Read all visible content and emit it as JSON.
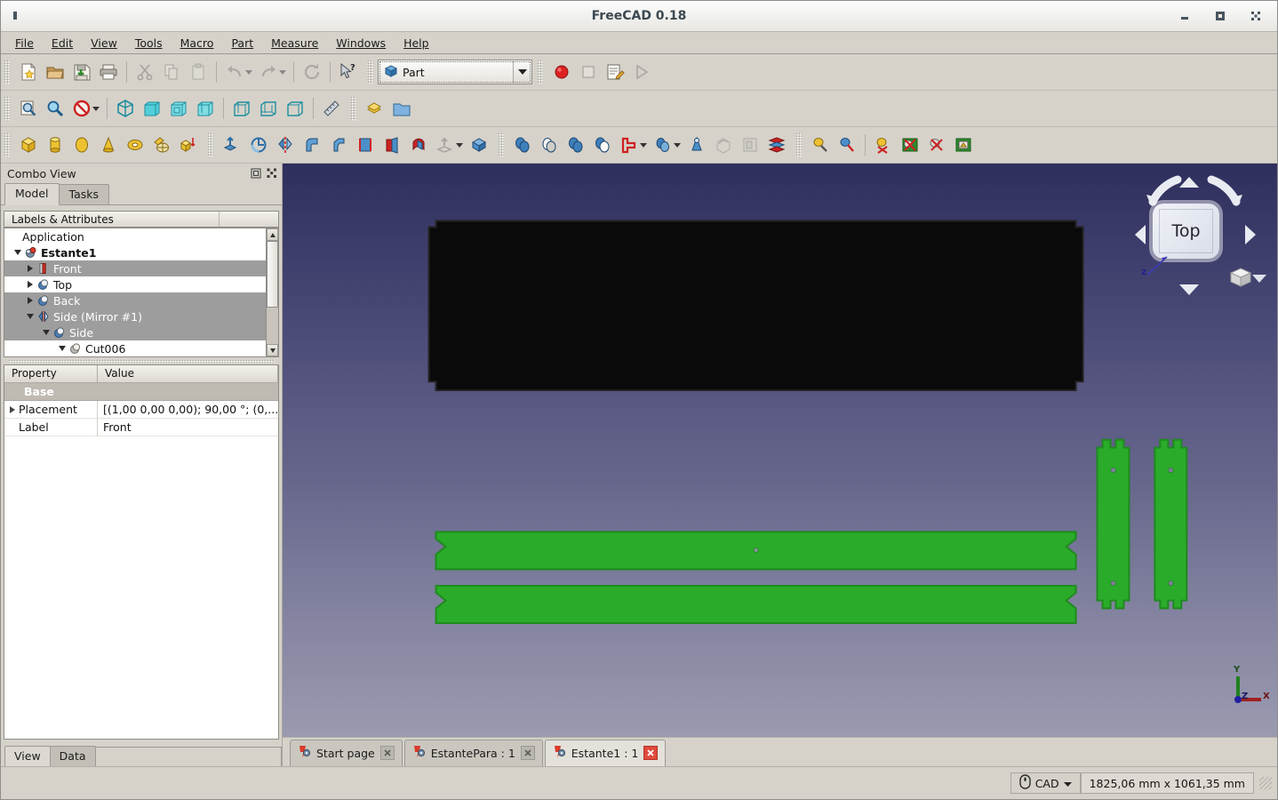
{
  "window": {
    "title": "FreeCAD 0.18",
    "minimize_label": "–",
    "maximize_label": "▫",
    "close_label": "✕"
  },
  "menubar": {
    "items": [
      {
        "label": "File"
      },
      {
        "label": "Edit"
      },
      {
        "label": "View"
      },
      {
        "label": "Tools"
      },
      {
        "label": "Macro"
      },
      {
        "label": "Part"
      },
      {
        "label": "Measure"
      },
      {
        "label": "Windows"
      },
      {
        "label": "Help"
      }
    ]
  },
  "toolbars": {
    "file": [
      "new-document-icon",
      "open-document-icon",
      "save-document-icon",
      "print-icon",
      "cut-icon",
      "copy-icon",
      "paste-icon",
      "undo-icon",
      "redo-icon",
      "refresh-icon",
      "whats-this-icon"
    ],
    "workbench": {
      "selected": "Part"
    },
    "macro": [
      "macro-record-icon",
      "macro-stop-icon",
      "macro-edit-icon",
      "macro-execute-icon"
    ],
    "view": [
      "fit-all-icon",
      "fit-selection-icon",
      "draw-style-icon",
      "axonometric-icon",
      "front-view-icon",
      "top-view-icon",
      "right-view-icon",
      "rear-view-icon",
      "bottom-view-icon",
      "left-view-icon",
      "measure-icon"
    ],
    "structure": [
      "create-part-icon",
      "create-group-icon"
    ],
    "primitives": [
      "box-icon",
      "cylinder-icon",
      "sphere-icon",
      "cone-icon",
      "torus-icon",
      "shape-builder-icon",
      "primitives-icon"
    ],
    "modeling": [
      "extrude-icon",
      "revolve-icon",
      "mirror-icon",
      "fillet-icon",
      "chamfer-icon",
      "ruled-surface-icon",
      "loft-icon",
      "sweep-icon",
      "offset-icon",
      "thickness-icon"
    ],
    "boolean": [
      "boolean-icon",
      "cut-icon",
      "union-icon",
      "common-icon",
      "join-connect-icon",
      "split-boolean-icon",
      "compound-icon",
      "check-geometry-icon",
      "defeaturing-icon",
      "cross-sections-icon"
    ],
    "measure_tools": [
      "measure-linear-icon",
      "measure-angular-icon",
      "measure-refresh-icon",
      "measure-toggle-all-icon",
      "measure-toggle-3d-icon",
      "measure-toggle-delta-icon"
    ]
  },
  "combo_view": {
    "title": "Combo View",
    "float_button": "float-icon",
    "close_button": "close-icon",
    "tabs": [
      {
        "label": "Model",
        "active": true
      },
      {
        "label": "Tasks",
        "active": false
      }
    ],
    "tree_header": "Labels & Attributes",
    "tree": [
      {
        "label": "Application",
        "indent": 0,
        "twisty": "none",
        "icon": "none",
        "selected": false,
        "bold": false
      },
      {
        "label": "Estante1",
        "indent": 1,
        "twisty": "down",
        "icon": "document-icon",
        "selected": false,
        "bold": true
      },
      {
        "label": "Front",
        "indent": 2,
        "twisty": "right",
        "icon": "extrude-icon",
        "selected": true,
        "bold": false
      },
      {
        "label": "Top",
        "indent": 2,
        "twisty": "right",
        "icon": "shape-icon",
        "selected": false,
        "bold": false
      },
      {
        "label": "Back",
        "indent": 2,
        "twisty": "right",
        "icon": "shape-icon",
        "selected": true,
        "bold": false
      },
      {
        "label": "Side (Mirror #1)",
        "indent": 2,
        "twisty": "down",
        "icon": "mirror-icon",
        "selected": true,
        "bold": false
      },
      {
        "label": "Side",
        "indent": 3,
        "twisty": "down",
        "icon": "shape-icon",
        "selected": true,
        "bold": false
      },
      {
        "label": "Cut006",
        "indent": 4,
        "twisty": "down",
        "icon": "cut-shape-icon",
        "selected": false,
        "bold": false
      }
    ],
    "property_editor": {
      "headers": {
        "property": "Property",
        "value": "Value"
      },
      "rows": [
        {
          "kind": "group",
          "name": "Base",
          "value": ""
        },
        {
          "kind": "item",
          "name": "Placement",
          "value": "[(1,00 0,00 0,00); 90,00 °; (0,...",
          "expandable": true
        },
        {
          "kind": "item",
          "name": "Label",
          "value": "Front",
          "expandable": false
        }
      ]
    },
    "bottom_tabs": [
      {
        "label": "View",
        "active": true
      },
      {
        "label": "Data",
        "active": false
      }
    ]
  },
  "viewport": {
    "nav_cube": {
      "face_label": "Top",
      "axis_hint": "z"
    },
    "axis_indicator": {
      "x_label": "X",
      "y_label": "Y",
      "z_label": "Z",
      "x_color": "#a02020",
      "y_color": "#208020",
      "z_color": "#2020a0"
    },
    "colors": {
      "background_top": "#2f2f5e",
      "background_bottom": "#9a9ab0",
      "part_black": "#0a0a0a",
      "part_green": "#2aac2a"
    }
  },
  "doc_tabs": [
    {
      "label": "Start page",
      "active": false,
      "close_label": "✕"
    },
    {
      "label": "EstantePara : 1",
      "active": false,
      "close_label": "✕"
    },
    {
      "label": "Estante1 : 1",
      "active": true,
      "close_label": "✕"
    }
  ],
  "statusbar": {
    "navigation_style": "CAD",
    "navigation_icon": "mouse-icon",
    "dimension_readout": "1825,06 mm x 1061,35 mm"
  }
}
